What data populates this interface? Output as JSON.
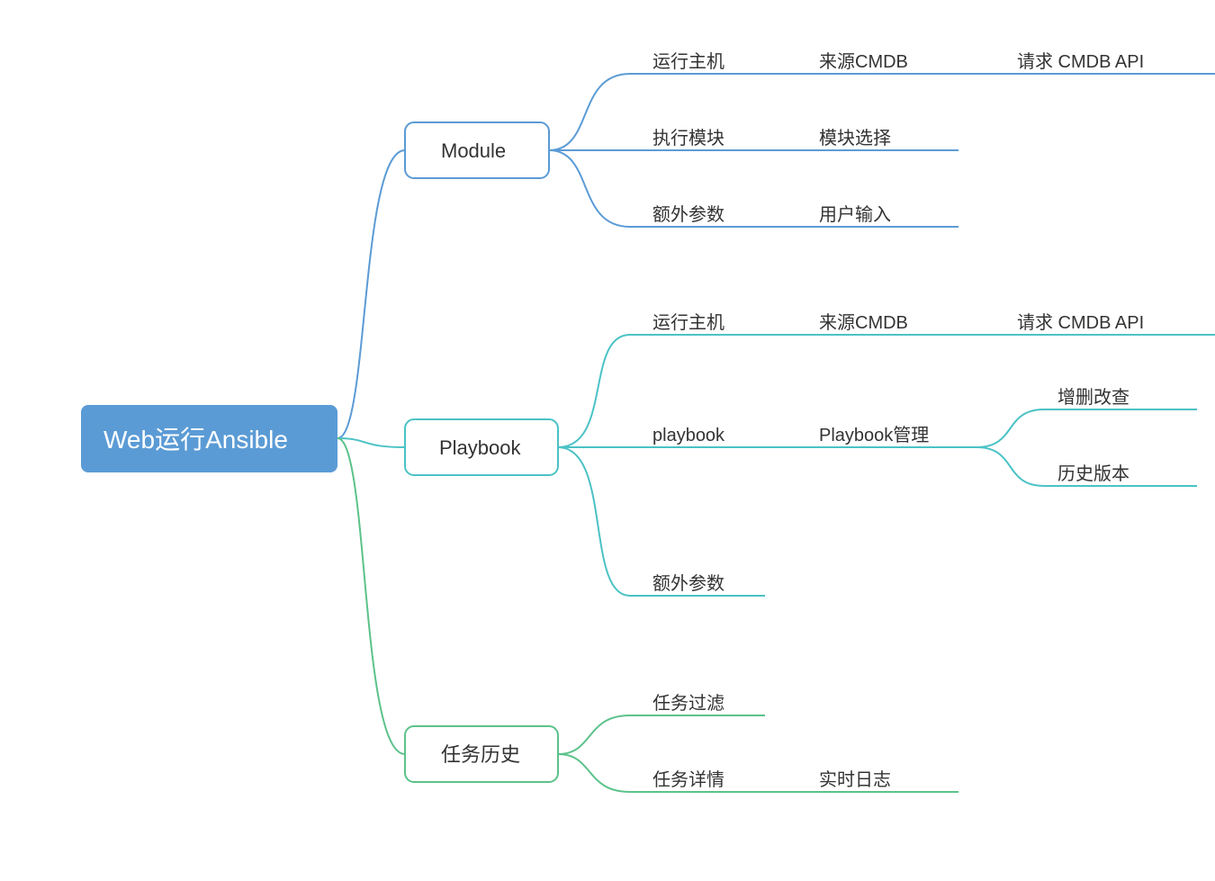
{
  "colors": {
    "root": "#5b9bd5",
    "blue": "#5b9bd5",
    "teal": "#4bc2c5",
    "green": "#5cc28a"
  },
  "root": {
    "label": "Web运行Ansible"
  },
  "branches": [
    {
      "id": "module",
      "label": "Module",
      "color": "blue",
      "children": [
        {
          "label": "运行主机",
          "children": [
            {
              "label": "来源CMDB",
              "children": [
                {
                  "label": "请求 CMDB API"
                }
              ]
            }
          ]
        },
        {
          "label": "执行模块",
          "children": [
            {
              "label": "模块选择"
            }
          ]
        },
        {
          "label": "额外参数",
          "children": [
            {
              "label": "用户输入"
            }
          ]
        }
      ]
    },
    {
      "id": "playbook",
      "label": "Playbook",
      "color": "teal",
      "children": [
        {
          "label": "运行主机",
          "children": [
            {
              "label": "来源CMDB",
              "children": [
                {
                  "label": "请求 CMDB API"
                }
              ]
            }
          ]
        },
        {
          "label": "playbook",
          "children": [
            {
              "label": "Playbook管理",
              "children": [
                {
                  "label": "增删改查"
                },
                {
                  "label": "历史版本"
                }
              ]
            }
          ]
        },
        {
          "label": "额外参数"
        }
      ]
    },
    {
      "id": "history",
      "label": "任务历史",
      "color": "green",
      "children": [
        {
          "label": "任务过滤"
        },
        {
          "label": "任务详情",
          "children": [
            {
              "label": "实时日志"
            }
          ]
        }
      ]
    }
  ]
}
